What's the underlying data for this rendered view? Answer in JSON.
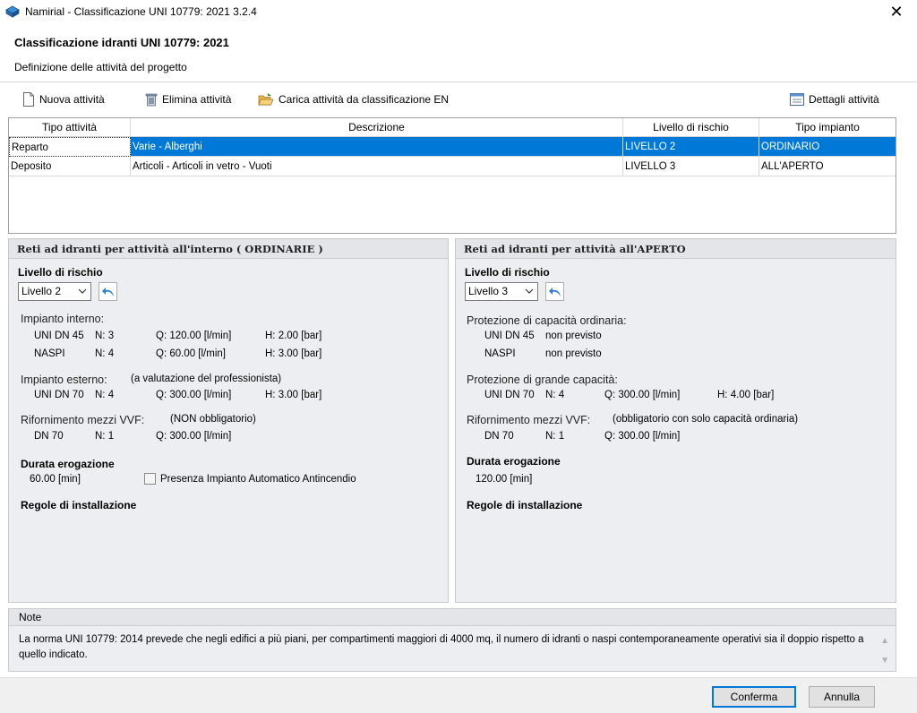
{
  "window": {
    "title": "Namirial - Classificazione UNI 10779: 2021 3.2.4",
    "close": "✕"
  },
  "header": {
    "title": "Classificazione idranti UNI 10779: 2021",
    "subtitle": "Definizione delle attività del progetto"
  },
  "toolbar": {
    "new_label": "Nuova attività",
    "delete_label": "Elimina attività",
    "load_label": "Carica attività da classificazione EN",
    "details_label": "Dettagli attività"
  },
  "grid": {
    "columns": [
      "Tipo attività",
      "Descrizione",
      "Livello di rischio",
      "Tipo impianto"
    ],
    "rows": [
      {
        "tipo": "Reparto",
        "descrizione": "Varie - Alberghi",
        "livello": "LIVELLO 2",
        "impianto": "ORDINARIO"
      },
      {
        "tipo": "Deposito",
        "descrizione": "Articoli - Articoli in vetro - Vuoti",
        "livello": "LIVELLO 3",
        "impianto": "ALL'APERTO"
      }
    ],
    "selected_row": 0
  },
  "left_panel": {
    "title": "Reti ad idranti per attività all'interno ( ORDINARIE )",
    "risk_label": "Livello di rischio",
    "risk_value": "Livello 2",
    "interno": {
      "label": "Impianto interno:",
      "r1": {
        "type": "UNI DN 45",
        "n": "N: 3",
        "q": "Q: 120.00 [l/min]",
        "h": "H: 2.00 [bar]"
      },
      "r2": {
        "type": "NASPI",
        "n": "N: 4",
        "q": "Q: 60.00 [l/min]",
        "h": "H: 3.00 [bar]"
      }
    },
    "esterno": {
      "label": "Impianto esterno:",
      "note": "(a valutazione del professionista)",
      "r1": {
        "type": "UNI DN 70",
        "n": "N: 4",
        "q": "Q: 300.00 [l/min]",
        "h": "H: 3.00 [bar]"
      }
    },
    "vvf": {
      "label": "Rifornimento mezzi VVF:",
      "note": "(NON obbligatorio)",
      "r1": {
        "type": "DN 70",
        "n": "N: 1",
        "q": "Q: 300.00 [l/min]"
      }
    },
    "durata_label": "Durata erogazione",
    "durata_value": "60.00 [min]",
    "automatico_label": "Presenza Impianto Automatico Antincendio",
    "regole_label": "Regole di installazione"
  },
  "right_panel": {
    "title": "Reti ad idranti per attività all'APERTO",
    "risk_label": "Livello di rischio",
    "risk_value": "Livello 3",
    "ordinaria": {
      "label": "Protezione di capacità ordinaria:",
      "r1": {
        "type": "UNI DN 45",
        "value": "non previsto"
      },
      "r2": {
        "type": "NASPI",
        "value": "non previsto"
      }
    },
    "grande": {
      "label": "Protezione di grande capacità:",
      "r1": {
        "type": "UNI DN 70",
        "n": "N: 4",
        "q": "Q: 300.00 [l/min]",
        "h": "H: 4.00 [bar]"
      }
    },
    "vvf": {
      "label": "Rifornimento mezzi VVF:",
      "note": "(obbligatorio con solo capacità ordinaria)",
      "r1": {
        "type": "DN 70",
        "n": "N: 1",
        "q": "Q: 300.00 [l/min]"
      }
    },
    "durata_label": "Durata erogazione",
    "durata_value": "120.00 [min]",
    "regole_label": "Regole di installazione"
  },
  "note": {
    "title": "Note",
    "text": "La norma UNI 10779: 2014 prevede che negli edifici a più piani, per compartimenti maggiori di 4000 mq, il numero di idranti o naspi contemporaneamente operativi sia il doppio rispetto a quello indicato."
  },
  "footer": {
    "confirm_label": "Conferma",
    "cancel_label": "Annulla"
  },
  "colors": {
    "selection": "#0078d7",
    "panel_bg": "#eceef1",
    "panel_header": "#e3e5e9"
  }
}
